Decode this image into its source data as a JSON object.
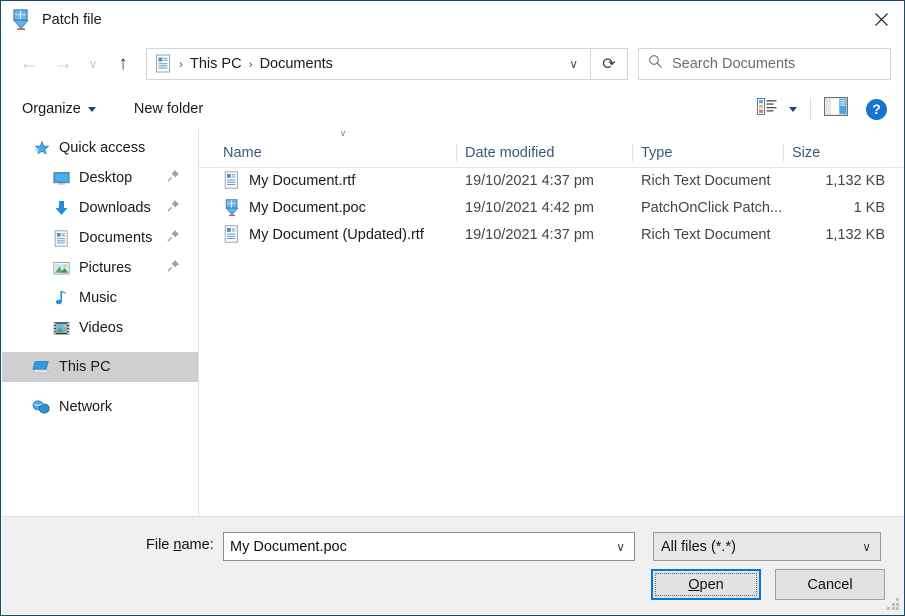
{
  "window": {
    "title": "Patch file",
    "icon": "patch-file-icon",
    "close_label": "✕",
    "border_color": "#1b4a68"
  },
  "navbar": {
    "back_icon": "←",
    "forward_icon": "→",
    "history_icon": "∨",
    "up_icon": "↑",
    "breadcrumb": {
      "icon": "documents-folder-icon",
      "separator": "›",
      "items": [
        "This PC",
        "Documents"
      ],
      "dropdown_icon": "∨"
    },
    "refresh_icon": "⟳",
    "search": {
      "icon": "search-icon",
      "placeholder": "Search Documents"
    }
  },
  "toolbar": {
    "organize_label": "Organize",
    "new_folder_label": "New folder",
    "view_icon": "view-list-icon",
    "view_caret": "▾",
    "preview_pane_icon": "preview-pane-icon",
    "help_label": "?"
  },
  "sidebar": {
    "items": [
      {
        "label": "Quick access",
        "icon": "star-icon",
        "level": 0,
        "pinned": false,
        "selected": false
      },
      {
        "label": "Desktop",
        "icon": "desktop-icon",
        "level": 1,
        "pinned": true,
        "selected": false
      },
      {
        "label": "Downloads",
        "icon": "download-icon",
        "level": 1,
        "pinned": true,
        "selected": false
      },
      {
        "label": "Documents",
        "icon": "documents-icon",
        "level": 1,
        "pinned": true,
        "selected": false
      },
      {
        "label": "Pictures",
        "icon": "pictures-icon",
        "level": 1,
        "pinned": true,
        "selected": false
      },
      {
        "label": "Music",
        "icon": "music-icon",
        "level": 1,
        "pinned": false,
        "selected": false
      },
      {
        "label": "Videos",
        "icon": "videos-icon",
        "level": 1,
        "pinned": false,
        "selected": false
      },
      {
        "label": "This PC",
        "icon": "this-pc-icon",
        "level": 0,
        "pinned": false,
        "selected": true
      },
      {
        "label": "Network",
        "icon": "network-icon",
        "level": 0,
        "pinned": false,
        "selected": false
      }
    ],
    "pin_icon": "pin-icon",
    "selected_color": "#cfcfcf"
  },
  "filelist": {
    "sort_indicator": "∨",
    "columns": [
      "Name",
      "Date modified",
      "Type",
      "Size"
    ],
    "rows": [
      {
        "name": "My Document.rtf",
        "date": "19/10/2021 4:37 pm",
        "type": "Rich Text Document",
        "size": "1,132 KB",
        "icon": "rtf-document-icon"
      },
      {
        "name": "My Document.poc",
        "date": "19/10/2021 4:42 pm",
        "type": "PatchOnClick Patch...",
        "size": "1 KB",
        "icon": "patch-file-icon"
      },
      {
        "name": "My Document (Updated).rtf",
        "date": "19/10/2021 4:37 pm",
        "type": "Rich Text Document",
        "size": "1,132 KB",
        "icon": "rtf-document-icon"
      }
    ]
  },
  "footer": {
    "filename_label_pre": "File ",
    "filename_label_accel": "n",
    "filename_label_post": "ame:",
    "filename_value": "My Document.poc",
    "filename_dropdown_icon": "∨",
    "filter_value": "All files (*.*)",
    "filter_dropdown_icon": "∨",
    "open_label_accel": "O",
    "open_label_rest": "pen",
    "cancel_label": "Cancel",
    "accent_color": "#0078d7"
  }
}
